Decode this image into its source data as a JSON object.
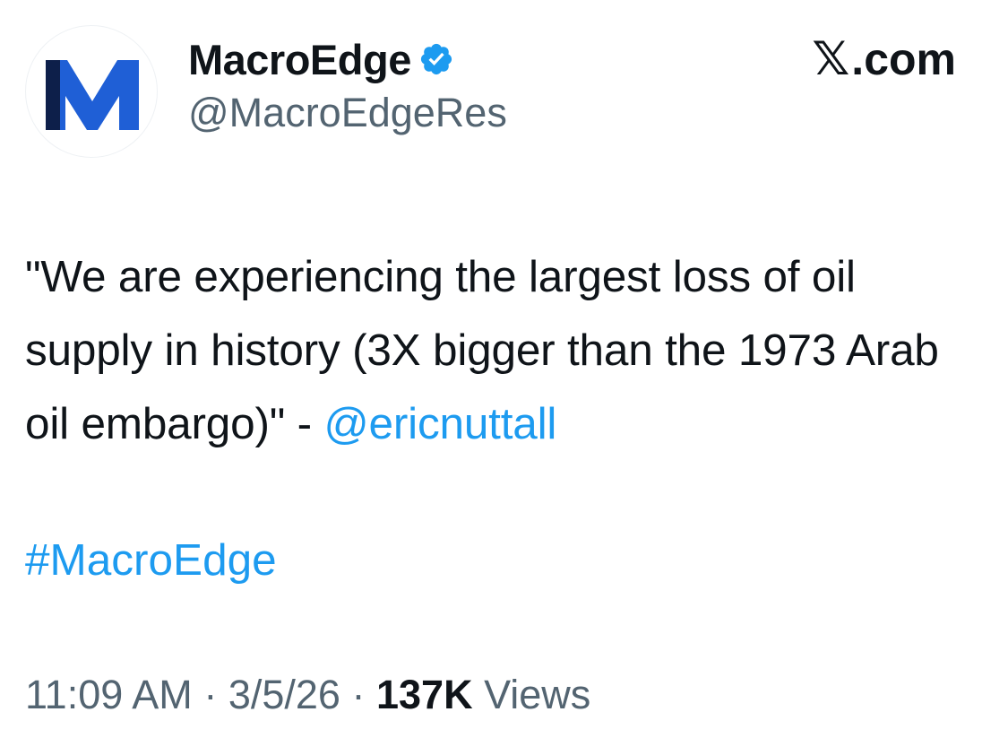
{
  "author": {
    "display_name": "MacroEdge",
    "handle": "@MacroEdgeRes",
    "avatar_letter": "M",
    "verified": true
  },
  "brand": {
    "glyph": "𝕏",
    "text": ".com"
  },
  "tweet": {
    "text_before_mention": "\"We are experiencing the largest loss of oil supply in history (3X bigger than the 1973 Arab oil embargo)\" - ",
    "mention": "@ericnuttall",
    "hashtag": "#MacroEdge"
  },
  "meta": {
    "time": "11:09 AM",
    "separator": "·",
    "date": "3/5/26",
    "views_count": "137K",
    "views_label": "Views"
  },
  "colors": {
    "link": "#1d9bf0",
    "verified": "#1d9bf0",
    "secondary_text": "#536471",
    "primary_text": "#0f1419",
    "logo_dark": "#0d1f4a",
    "logo_blue": "#1f5fd6"
  },
  "icons": {
    "verified": "verified-badge-icon",
    "logo": "macroedge-m-logo"
  }
}
